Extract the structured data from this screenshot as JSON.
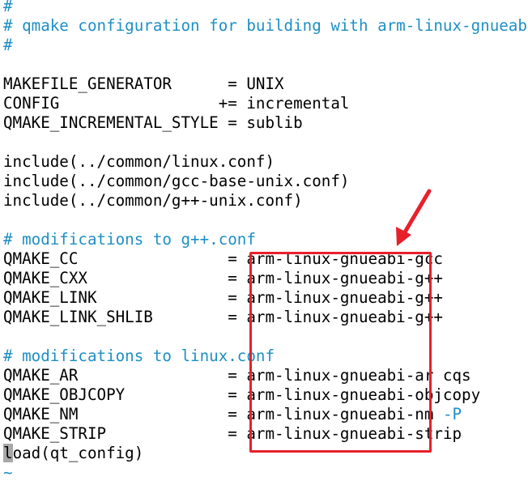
{
  "editor": {
    "lines": [
      {
        "text": "#",
        "kind": "comment"
      },
      {
        "text": "# qmake configuration for building with arm-linux-gnueabi-g++",
        "kind": "comment"
      },
      {
        "text": "#",
        "kind": "comment"
      },
      {
        "text": "",
        "kind": "blank"
      },
      {
        "text": "MAKEFILE_GENERATOR      = UNIX",
        "kind": "code"
      },
      {
        "text": "CONFIG                 += incremental",
        "kind": "code"
      },
      {
        "text": "QMAKE_INCREMENTAL_STYLE = sublib",
        "kind": "code"
      },
      {
        "text": "",
        "kind": "blank"
      },
      {
        "text": "include(../common/linux.conf)",
        "kind": "code"
      },
      {
        "text": "include(../common/gcc-base-unix.conf)",
        "kind": "code"
      },
      {
        "text": "include(../common/g++-unix.conf)",
        "kind": "code"
      },
      {
        "text": "",
        "kind": "blank"
      },
      {
        "text": "# modifications to g++.conf",
        "kind": "comment"
      },
      {
        "text": "QMAKE_CC                = arm-linux-gnueabi-gcc",
        "kind": "code"
      },
      {
        "text": "QMAKE_CXX               = arm-linux-gnueabi-g++",
        "kind": "code"
      },
      {
        "text": "QMAKE_LINK              = arm-linux-gnueabi-g++",
        "kind": "code"
      },
      {
        "text": "QMAKE_LINK_SHLIB        = arm-linux-gnueabi-g++",
        "kind": "code"
      },
      {
        "text": "",
        "kind": "blank"
      },
      {
        "text": "# modifications to linux.conf",
        "kind": "comment"
      },
      {
        "text": "QMAKE_AR                = arm-linux-gnueabi-ar cqs",
        "kind": "code"
      },
      {
        "text": "QMAKE_OBJCOPY           = arm-linux-gnueabi-objcopy",
        "kind": "code"
      },
      {
        "text": "QMAKE_NM                = arm-linux-gnueabi-nm ",
        "kind": "code",
        "suffix": "-P"
      },
      {
        "text": "QMAKE_STRIP             = arm-linux-gnueabi-strip",
        "kind": "code"
      },
      {
        "text": "oad(qt_config)",
        "kind": "code",
        "cursor_char": "l"
      },
      {
        "text": "~",
        "kind": "tilde"
      }
    ]
  },
  "colors": {
    "comment": "#1e8fc4",
    "annotation": "#e8202a",
    "cursor": "#a8a8a8"
  },
  "annotation": {
    "shape": "rectangle-with-arrow",
    "icon": "arrow-down-left-icon"
  }
}
